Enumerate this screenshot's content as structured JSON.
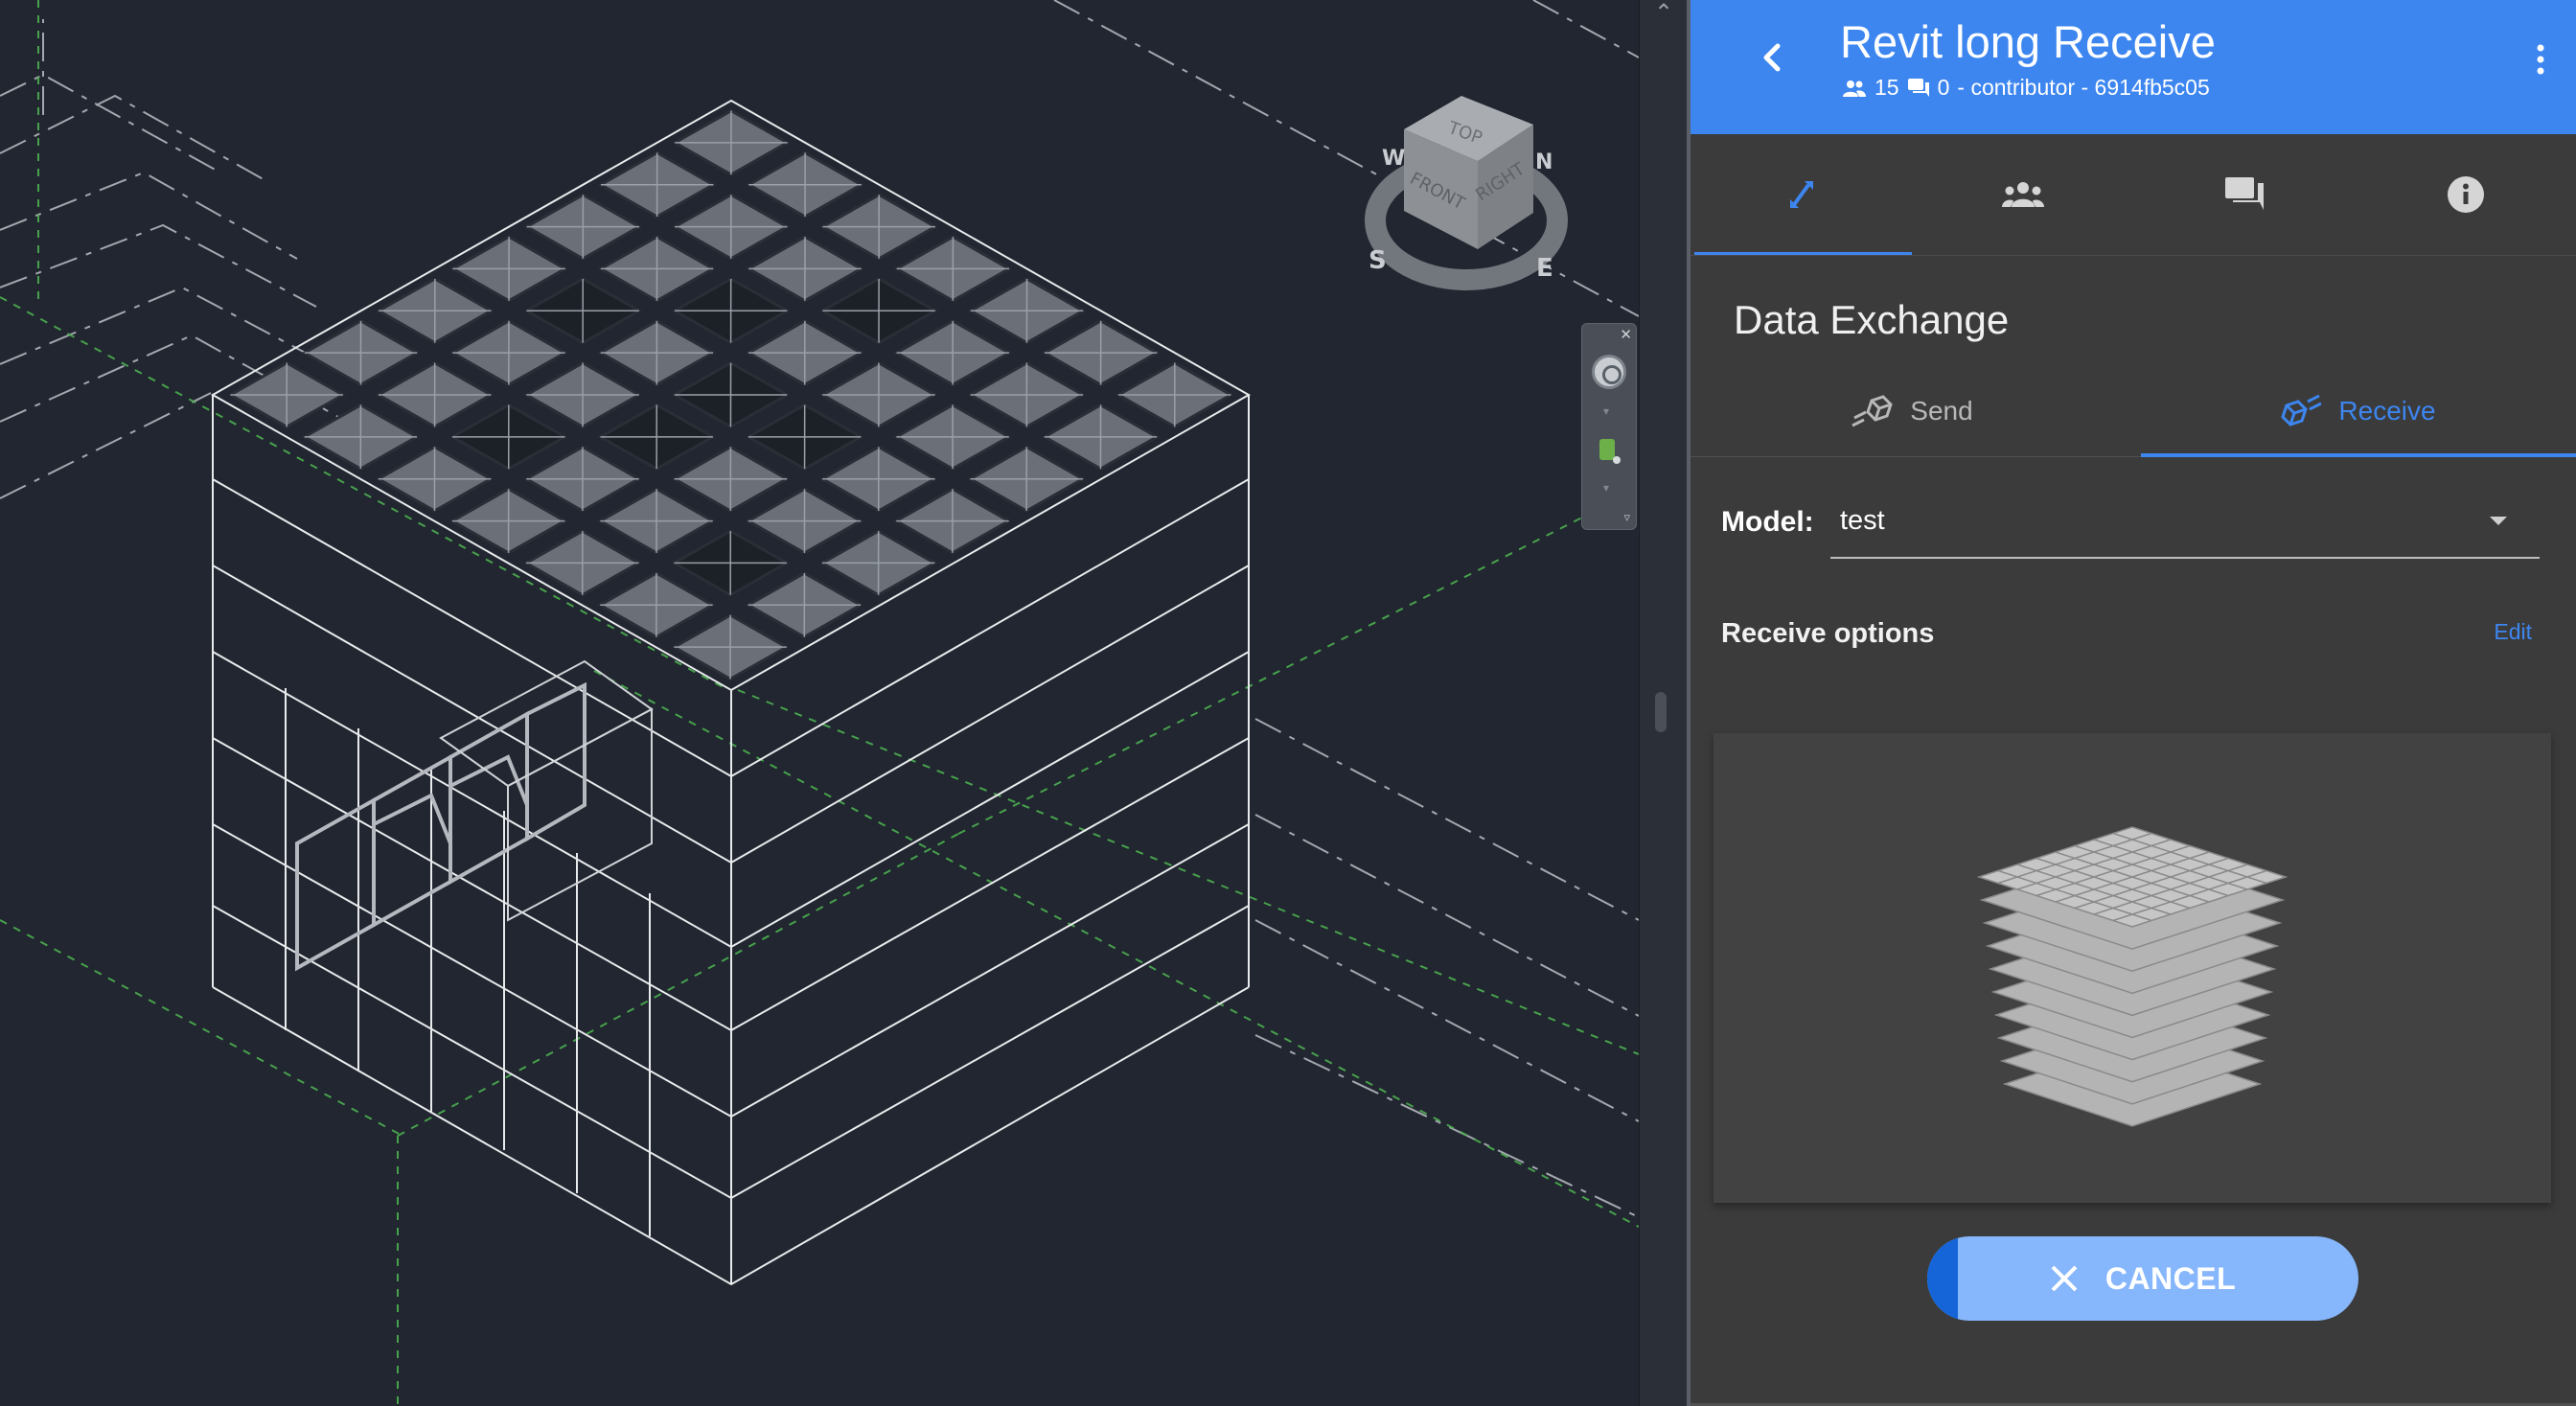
{
  "header": {
    "title": "Revit long Receive",
    "members_count": "15",
    "comments_count": "0",
    "meta_text": "- contributor - 6914fb5c05",
    "back_icon": "chevron-left-icon",
    "menu_icon": "kebab-menu-icon"
  },
  "tabs": [
    {
      "name": "data-exchange",
      "icon": "transfer-icon",
      "active": true
    },
    {
      "name": "collaborators",
      "icon": "people-icon",
      "active": false
    },
    {
      "name": "comments",
      "icon": "comments-icon",
      "active": false
    },
    {
      "name": "info",
      "icon": "info-icon",
      "active": false
    }
  ],
  "exchange": {
    "section_title": "Data Exchange",
    "send_label": "Send",
    "receive_label": "Receive",
    "active_subtab": "Receive"
  },
  "model": {
    "label": "Model:",
    "selected": "test"
  },
  "receive_options": {
    "label": "Receive options",
    "edit_label": "Edit"
  },
  "cancel": {
    "label": "CANCEL",
    "progress": 0.07
  },
  "viewcube": {
    "top": "TOP",
    "front": "FRONT",
    "right": "RIGHT",
    "north": "N",
    "south": "S",
    "east": "E",
    "west": "W"
  },
  "colors": {
    "accent": "#3d86f0",
    "panel_bg": "#3b3b3b",
    "viewport_bg": "#212630",
    "button_bg": "#86b6fb"
  }
}
